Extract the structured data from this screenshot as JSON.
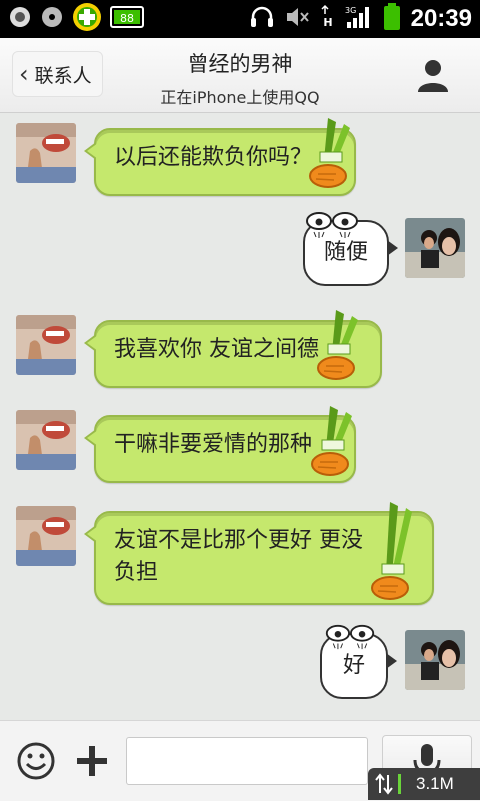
{
  "status_bar": {
    "time": "20:39",
    "network_type": "3G",
    "icons": [
      "record-icon",
      "disc-icon",
      "360-security-icon",
      "battery-widget-icon",
      "headset-icon",
      "mute-icon",
      "data-transfer-icon",
      "signal-icon",
      "battery-icon"
    ]
  },
  "header": {
    "back_label": "联系人",
    "title": "曾经的男神",
    "subtitle": "正在iPhone上使用QQ"
  },
  "messages": [
    {
      "side": "incoming",
      "text": "以后还能欺负你吗？"
    },
    {
      "side": "outgoing",
      "text": "随便"
    },
    {
      "side": "incoming",
      "text": "我喜欢你 友谊之间德"
    },
    {
      "side": "incoming",
      "text": "干嘛非要爱情的那种"
    },
    {
      "side": "incoming",
      "text_line1": "友谊不是比那个更好  更没",
      "text_line2": "负担"
    },
    {
      "side": "outgoing",
      "text": "好"
    }
  ],
  "input_bar": {
    "placeholder": "",
    "icons": [
      "emoji-icon",
      "plus-icon",
      "microphone-icon"
    ]
  },
  "net_speed": "3.1M",
  "colors": {
    "incoming_bubble": "#c5e86d",
    "incoming_border": "#98b94a",
    "outgoing_bubble": "#ffffff",
    "background": "#e7e9e7",
    "status_bar": "#000000"
  }
}
